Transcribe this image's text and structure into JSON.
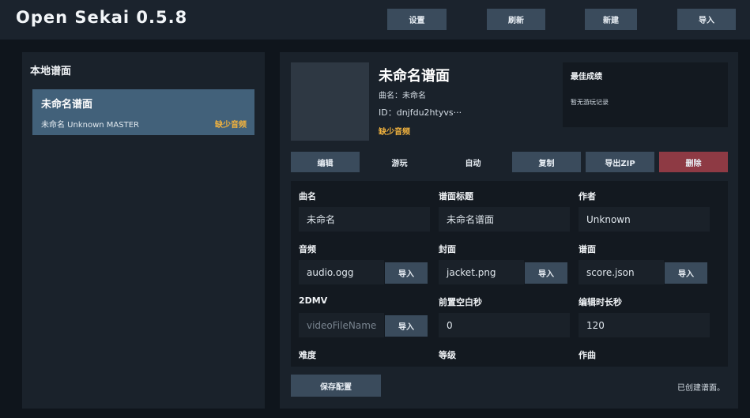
{
  "app": {
    "title": "Open Sekai 0.5.8"
  },
  "topbar": {
    "settings": "设置",
    "refresh": "刷新",
    "new": "新建",
    "import": "导入"
  },
  "sidebar": {
    "title": "本地谱面",
    "items": [
      {
        "title": "未命名谱面",
        "meta": "未命名  Unknown  MASTER",
        "warning": "缺少音频",
        "selected": true
      }
    ]
  },
  "detail": {
    "title": "未命名谱面",
    "song_line": "曲名：未命名",
    "id_line": "ID：dnjfdu2htyvs···",
    "warning": "缺少音频",
    "best": {
      "title": "最佳成绩",
      "empty": "暂无游玩记录"
    },
    "actions": {
      "edit": "编辑",
      "play": "游玩",
      "auto": "自动",
      "copy": "复制",
      "export": "导出ZIP",
      "delete": "删除"
    }
  },
  "form": {
    "song_name": {
      "label": "曲名",
      "value": "未命名"
    },
    "chart_title": {
      "label": "谱面标题",
      "value": "未命名谱面"
    },
    "author": {
      "label": "作者",
      "value": "Unknown"
    },
    "audio": {
      "label": "音频",
      "value": "audio.ogg",
      "button": "导入"
    },
    "cover": {
      "label": "封面",
      "value": "jacket.png",
      "button": "导入"
    },
    "score": {
      "label": "谱面",
      "value": "score.json",
      "button": "导入"
    },
    "dmv": {
      "label": "2DMV",
      "placeholder": "videoFileName",
      "button": "导入"
    },
    "lead_in": {
      "label": "前置空白秒",
      "value": "0"
    },
    "edit_length": {
      "label": "编辑时长秒",
      "value": "120"
    },
    "difficulty": {
      "label": "难度"
    },
    "level": {
      "label": "等级"
    },
    "composer": {
      "label": "作曲"
    }
  },
  "footer": {
    "save": "保存配置",
    "status": "已创建谱面。"
  },
  "colors": {
    "accent_button": "#3a4b5c",
    "selected_item": "#42617a",
    "warning": "#f1b23e",
    "danger": "#8e3a44"
  }
}
